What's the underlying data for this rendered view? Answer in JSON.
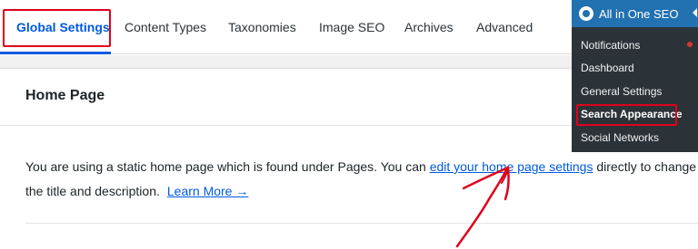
{
  "tabs": [
    {
      "label": "Global Settings",
      "active": true
    },
    {
      "label": "Content Types",
      "active": false
    },
    {
      "label": "Taxonomies",
      "active": false
    },
    {
      "label": "Image SEO",
      "active": false
    },
    {
      "label": "Archives",
      "active": false
    },
    {
      "label": "Advanced",
      "active": false
    }
  ],
  "panel": {
    "title": "Home Page",
    "text_before": "You are using a static home page which is found under Pages. You can ",
    "link_text": "edit your home page settings",
    "text_after": " directly to change the title and description.",
    "learn_more": "Learn More →"
  },
  "menu": {
    "title": "All in One SEO",
    "items": [
      {
        "label": "Notifications",
        "badge": true
      },
      {
        "label": "Dashboard"
      },
      {
        "label": "General Settings"
      },
      {
        "label": "Search Appearance",
        "current": true
      },
      {
        "label": "Social Networks"
      }
    ]
  },
  "icons": {
    "menu_logo": "aioseo-logo-icon",
    "menu_caret": "caret-left-icon",
    "annotation": "red-arrow-icon"
  },
  "colors": {
    "accent": "#005ae0",
    "highlight": "#e0001b",
    "menu_bg": "#2c3338",
    "menu_head": "#2271b1"
  }
}
